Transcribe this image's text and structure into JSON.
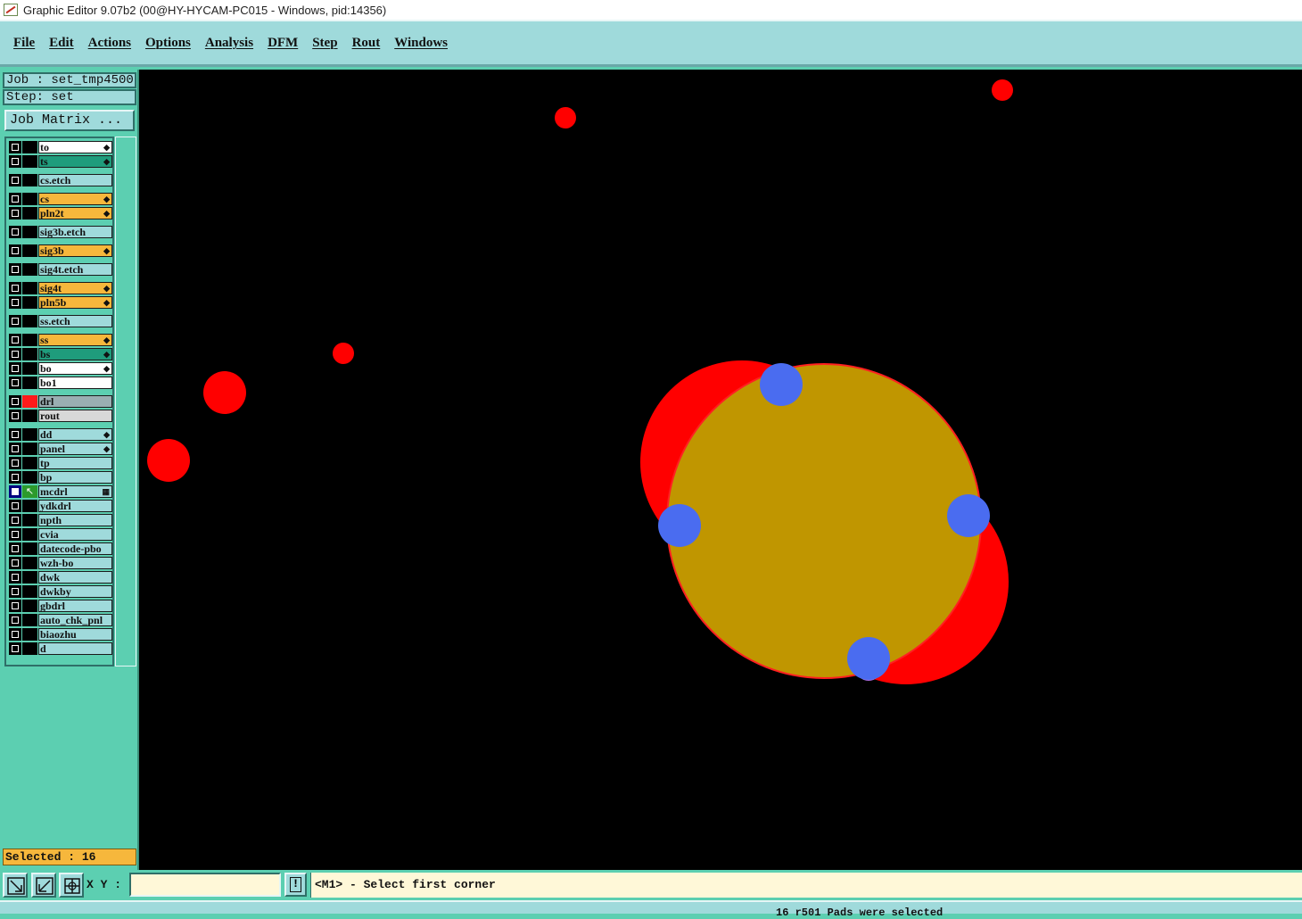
{
  "window": {
    "title": "Graphic Editor 9.07b2 (00@HY-HYCAM-PC015 - Windows, pid:14356)"
  },
  "menu": [
    "File",
    "Edit",
    "Actions",
    "Options",
    "Analysis",
    "DFM",
    "Step",
    "Rout",
    "Windows"
  ],
  "info": {
    "job": "Job : set_tmp4500",
    "step": "Step: set",
    "job_matrix": "Job Matrix ..."
  },
  "layers": [
    {
      "name": "to",
      "type": "board",
      "flag": "◆",
      "gap": 0
    },
    {
      "name": "ts",
      "type": "mask",
      "flag": "◆",
      "gap": 0
    },
    {
      "name": "cs.etch",
      "type": "drill",
      "flag": "",
      "gap": 1
    },
    {
      "name": "cs",
      "type": "sig",
      "flag": "◆",
      "gap": 1
    },
    {
      "name": "pln2t",
      "type": "sig",
      "flag": "◆",
      "gap": 0
    },
    {
      "name": "sig3b.etch",
      "type": "drill",
      "flag": "",
      "gap": 1
    },
    {
      "name": "sig3b",
      "type": "sig",
      "flag": "◆",
      "gap": 1
    },
    {
      "name": "sig4t.etch",
      "type": "drill",
      "flag": "",
      "gap": 1
    },
    {
      "name": "sig4t",
      "type": "sig",
      "flag": "◆",
      "gap": 1
    },
    {
      "name": "pln5b",
      "type": "sig",
      "flag": "◆",
      "gap": 0
    },
    {
      "name": "ss.etch",
      "type": "drill",
      "flag": "",
      "gap": 1
    },
    {
      "name": "ss",
      "type": "sig",
      "flag": "◆",
      "gap": 1
    },
    {
      "name": "bs",
      "type": "mask",
      "flag": "◆",
      "gap": 0
    },
    {
      "name": "bo",
      "type": "board",
      "flag": "◆",
      "gap": 0
    },
    {
      "name": "bo1",
      "type": "board",
      "flag": "",
      "gap": 0
    },
    {
      "name": "drl",
      "type": "drl",
      "flag": "",
      "gap": 1,
      "color": "red"
    },
    {
      "name": "rout",
      "type": "rout",
      "flag": "",
      "gap": 0
    },
    {
      "name": "dd",
      "type": "drill",
      "flag": "◆",
      "gap": 1
    },
    {
      "name": "panel",
      "type": "drill",
      "flag": "◆",
      "gap": 0
    },
    {
      "name": "tp",
      "type": "drill",
      "flag": "",
      "gap": 0
    },
    {
      "name": "bp",
      "type": "drill",
      "flag": "",
      "gap": 0
    },
    {
      "name": "mcdrl",
      "type": "drill",
      "flag": "▦",
      "gap": 0,
      "active": true
    },
    {
      "name": "ydkdrl",
      "type": "drill",
      "flag": "",
      "gap": 0
    },
    {
      "name": "npth",
      "type": "drill",
      "flag": "",
      "gap": 0
    },
    {
      "name": "cvia",
      "type": "drill",
      "flag": "",
      "gap": 0
    },
    {
      "name": "datecode-pbo",
      "type": "drill",
      "flag": "",
      "gap": 0
    },
    {
      "name": "wzh-bo",
      "type": "drill",
      "flag": "",
      "gap": 0
    },
    {
      "name": "dwk",
      "type": "drill",
      "flag": "",
      "gap": 0
    },
    {
      "name": "dwkby",
      "type": "drill",
      "flag": "",
      "gap": 0
    },
    {
      "name": "gbdrl",
      "type": "drill",
      "flag": "",
      "gap": 0
    },
    {
      "name": "auto_chk_pnl",
      "type": "drill",
      "flag": "",
      "gap": 0
    },
    {
      "name": "biaozhu",
      "type": "drill",
      "flag": "",
      "gap": 0
    },
    {
      "name": "d",
      "type": "drill",
      "flag": "",
      "gap": 0
    }
  ],
  "selected": "Selected : 16",
  "status": {
    "xy_label": "X Y :",
    "xy_value": "",
    "bang": "!",
    "prompt": "<M1> - Select first corner",
    "message": "16 r501 Pads were selected"
  },
  "colors": {
    "canvas_bg": "#000000",
    "drill_red": "#ff0000",
    "pad_gold": "#c09600",
    "pad_blue": "#4a6cf0",
    "pad_violet": "#b070e8"
  },
  "icons": {
    "zoom_box": "diagonal-arrow-icon",
    "zoom_fit": "fit-icon",
    "snap": "grid-snap-icon"
  }
}
